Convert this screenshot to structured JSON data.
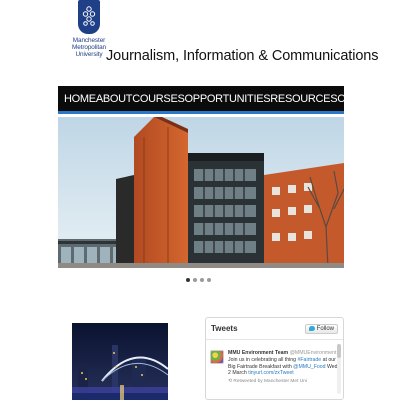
{
  "header": {
    "logo_lines": [
      "Manchester",
      "Metropolitan",
      "University"
    ],
    "site_title": "Journalism, Information & Communications"
  },
  "nav": {
    "items": [
      {
        "label": "HOME"
      },
      {
        "label": "ABOUT"
      },
      {
        "label": "COURSES"
      },
      {
        "label": "OPPORTUNITIES"
      },
      {
        "label": "RESOURCES"
      },
      {
        "label": "CONTACT"
      }
    ]
  },
  "slider": {
    "dot_count": 4,
    "active_index": 0
  },
  "tweets": {
    "title": "Tweets",
    "follow_label": "Follow",
    "items": [
      {
        "author_name": "MMU Environment Team",
        "author_handle": "@MMUEnvironment",
        "text_before": "Join us in celebrating all thing ",
        "hashtag": "#Fairtrade",
        "text_mid": " at our Big Fairtrade Breakfast with ",
        "mention": "@MMU_Food",
        "text_after": " Wed 2 March ",
        "link": "tinyurl.com/zxTweet",
        "retweet_note": "Retweeted by Manchester Met Uni"
      }
    ]
  },
  "colors": {
    "nav_background": "#0b0b0b",
    "nav_accent": "#2b78c8",
    "logo_blue": "#1f3f86",
    "twitter_link": "#2a7bc4"
  }
}
